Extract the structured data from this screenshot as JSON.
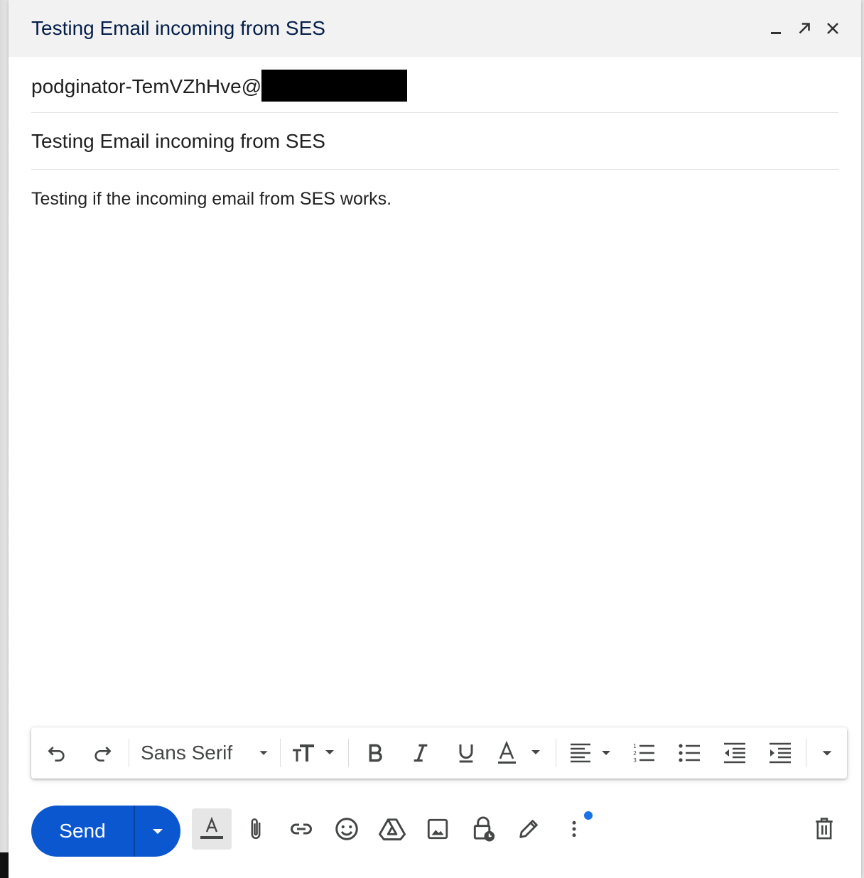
{
  "window": {
    "title": "Testing Email incoming from SES",
    "minimize_label": "_"
  },
  "compose": {
    "to_value": "podginator-TemVZhHve@",
    "subject_value": "Testing Email incoming from SES",
    "body_text": "Testing if the incoming email from SES works."
  },
  "toolbar": {
    "font_family": "Sans Serif"
  },
  "actions": {
    "send_label": "Send"
  },
  "colors": {
    "send_blue": "#0b57d0",
    "title_text": "#041e49",
    "icon_gray": "#444746",
    "notification_dot": "#1a73e8"
  },
  "icons": {
    "titlebar": [
      "minimize-icon",
      "pop-out-icon",
      "close-icon"
    ],
    "formatting": [
      "undo-icon",
      "redo-icon",
      "font-family-dropdown",
      "text-size-icon",
      "bold-icon",
      "italic-icon",
      "underline-icon",
      "text-color-icon",
      "align-icon",
      "numbered-list-icon",
      "bulleted-list-icon",
      "indent-less-icon",
      "indent-more-icon",
      "more-formatting-icon"
    ],
    "bottom": [
      "formatting-options-icon",
      "attach-icon",
      "link-icon",
      "emoji-icon",
      "drive-icon",
      "photo-icon",
      "confidential-mode-icon",
      "signature-icon",
      "more-options-icon",
      "discard-icon"
    ]
  }
}
